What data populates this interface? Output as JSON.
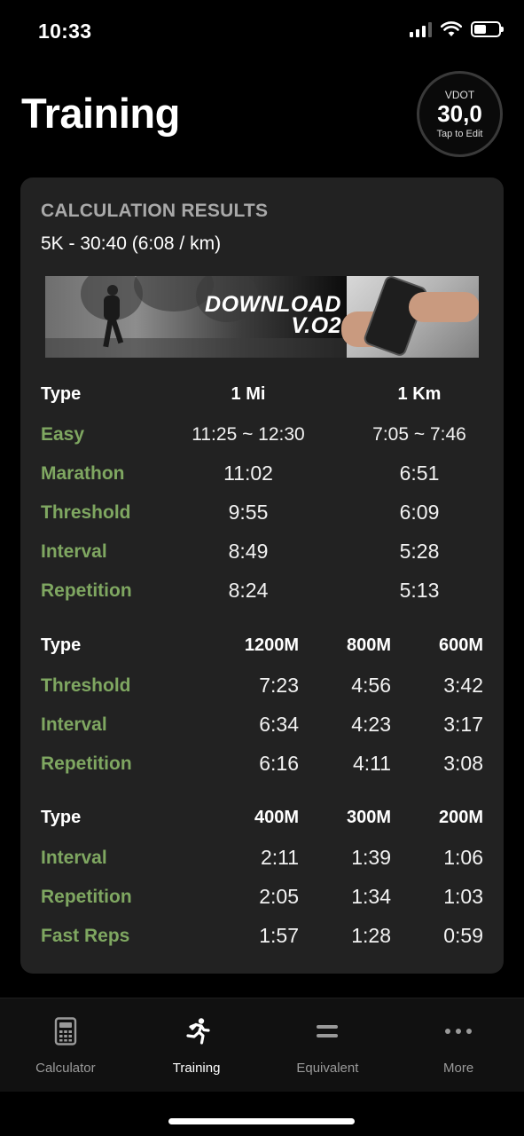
{
  "status_bar": {
    "time": "10:33"
  },
  "header": {
    "title": "Training",
    "vdot": {
      "label": "VDOT",
      "value": "30,0",
      "hint": "Tap to Edit"
    }
  },
  "card": {
    "heading": "CALCULATION RESULTS",
    "subtitle": "5K - 30:40 (6:08 / km)",
    "banner": {
      "line1": "DOWNLOAD",
      "line2": "V.O2"
    },
    "table1": {
      "headers": [
        "Type",
        "1 Mi",
        "1 Km"
      ],
      "rows": [
        [
          "Easy",
          "11:25 ~ 12:30",
          "7:05 ~ 7:46"
        ],
        [
          "Marathon",
          "11:02",
          "6:51"
        ],
        [
          "Threshold",
          "9:55",
          "6:09"
        ],
        [
          "Interval",
          "8:49",
          "5:28"
        ],
        [
          "Repetition",
          "8:24",
          "5:13"
        ]
      ]
    },
    "table2": {
      "headers": [
        "Type",
        "1200M",
        "800M",
        "600M"
      ],
      "rows": [
        [
          "Threshold",
          "7:23",
          "4:56",
          "3:42"
        ],
        [
          "Interval",
          "6:34",
          "4:23",
          "3:17"
        ],
        [
          "Repetition",
          "6:16",
          "4:11",
          "3:08"
        ]
      ]
    },
    "table3": {
      "headers": [
        "Type",
        "400M",
        "300M",
        "200M"
      ],
      "rows": [
        [
          "Interval",
          "2:11",
          "1:39",
          "1:06"
        ],
        [
          "Repetition",
          "2:05",
          "1:34",
          "1:03"
        ],
        [
          "Fast Reps",
          "1:57",
          "1:28",
          "0:59"
        ]
      ]
    }
  },
  "tabbar": {
    "tabs": [
      {
        "label": "Calculator",
        "icon": "calculator-icon"
      },
      {
        "label": "Training",
        "icon": "runner-icon",
        "active": true
      },
      {
        "label": "Equivalent",
        "icon": "equals-icon"
      },
      {
        "label": "More",
        "icon": "more-dots-icon"
      }
    ]
  },
  "colors": {
    "accent_green": "#7fa761",
    "card_bg": "#222222",
    "background": "#000000"
  }
}
